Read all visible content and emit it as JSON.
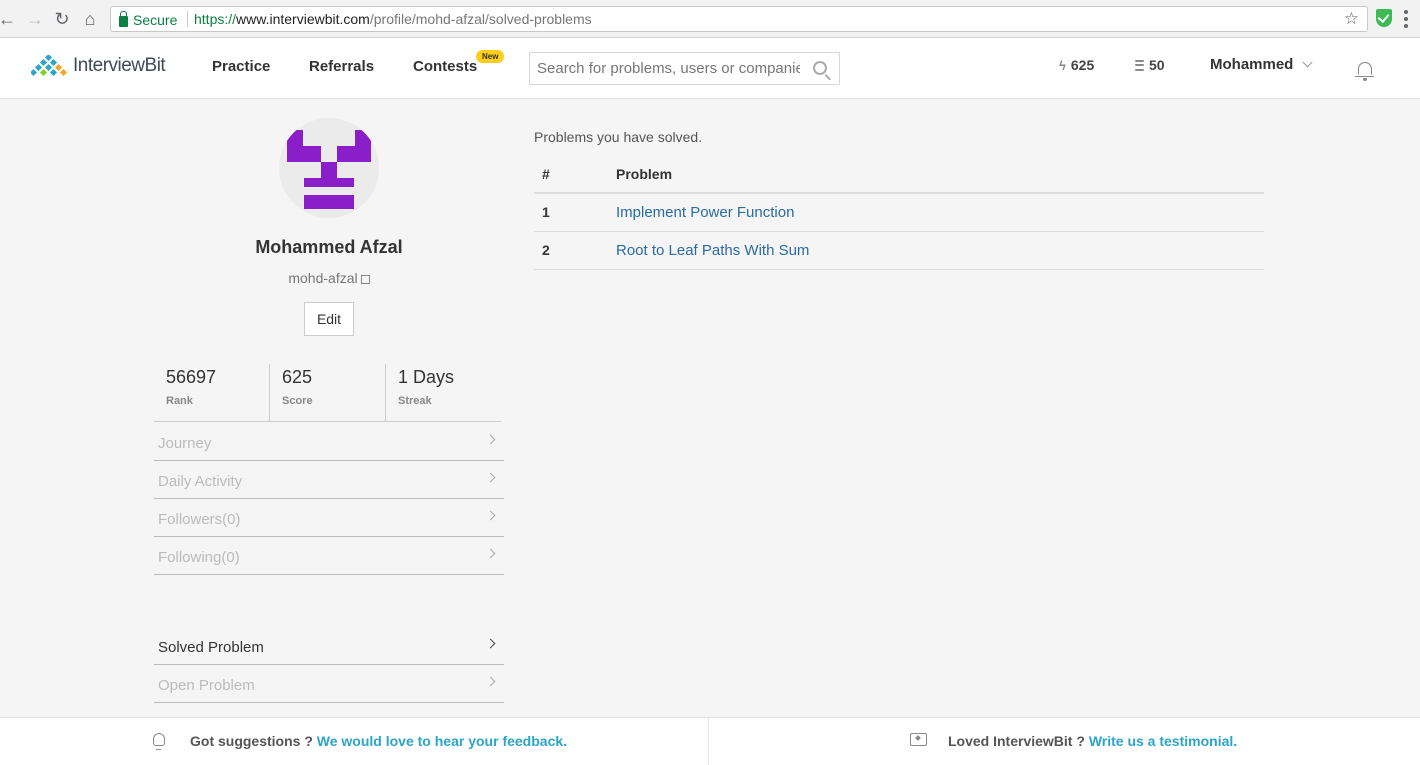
{
  "browser": {
    "secure_label": "Secure",
    "url_scheme": "https://",
    "url_host": "www.interviewbit.com",
    "url_path": "/profile/mohd-afzal/solved-problems"
  },
  "header": {
    "logo_text": "InterviewBit",
    "nav": {
      "practice": "Practice",
      "referrals": "Referrals",
      "contests": "Contests"
    },
    "new_badge": "New",
    "search_placeholder": "Search for problems, users or companies",
    "score_stat": "625",
    "coins_stat": "50",
    "user_name": "Mohammed"
  },
  "profile": {
    "name": "Mohammed Afzal",
    "handle": "mohd-afzal",
    "edit_label": "Edit",
    "stats": [
      {
        "value": "56697",
        "label": "Rank"
      },
      {
        "value": "625",
        "label": "Score"
      },
      {
        "value": "1 Days",
        "label": "Streak"
      }
    ],
    "menu": [
      "Journey",
      "Daily Activity",
      "Followers(0)",
      "Following(0)"
    ],
    "menu2": [
      "Solved Problem",
      "Open Problem"
    ]
  },
  "main": {
    "intro": "Problems you have solved.",
    "columns": {
      "index": "#",
      "problem": "Problem"
    },
    "problems": [
      {
        "index": "1",
        "name": "Implement Power Function"
      },
      {
        "index": "2",
        "name": "Root to Leaf Paths With Sum"
      }
    ]
  },
  "footer": {
    "suggestion_text": "Got suggestions ?",
    "suggestion_link": "We would love to hear your feedback.",
    "testimonial_text": "Loved InterviewBit ?",
    "testimonial_link": "Write us a testimonial."
  },
  "colors": {
    "accent_link": "#2b6aa7",
    "footer_link": "#2ba5c8",
    "avatar": "#8a1ec9",
    "badge": "#ffcd1b",
    "secure_green": "#0b8043"
  }
}
